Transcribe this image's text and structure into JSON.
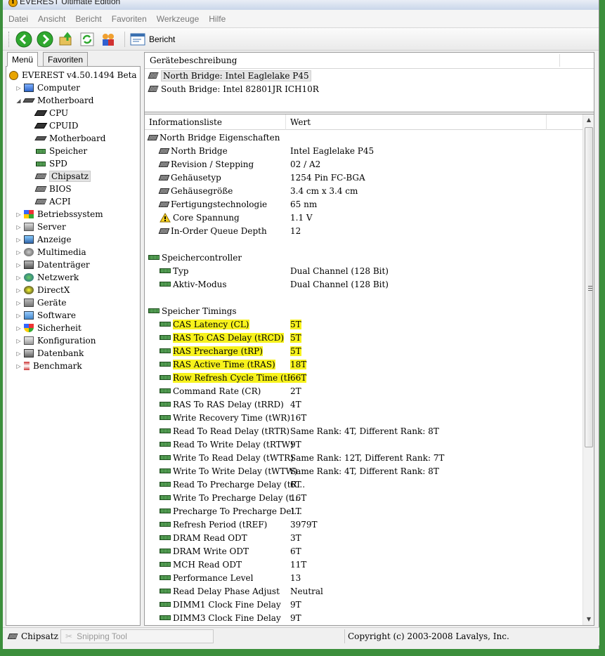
{
  "window": {
    "title": "EVEREST Ultimate Edition"
  },
  "menu": [
    "Datei",
    "Ansicht",
    "Bericht",
    "Favoriten",
    "Werkzeuge",
    "Hilfe"
  ],
  "toolbar": {
    "report_label": "Bericht"
  },
  "left_tabs": {
    "menu": "Menü",
    "favorites": "Favoriten"
  },
  "tree": [
    {
      "label": "EVEREST v4.50.1494 Beta",
      "icon": "info-icon",
      "level": 0,
      "exp": ""
    },
    {
      "label": "Computer",
      "icon": "computer-icon",
      "level": 1,
      "exp": "▷"
    },
    {
      "label": "Motherboard",
      "icon": "motherboard-icon",
      "level": 1,
      "exp": "◢"
    },
    {
      "label": "CPU",
      "icon": "cpu-icon",
      "level": 2,
      "exp": ""
    },
    {
      "label": "CPUID",
      "icon": "cpu-icon",
      "level": 2,
      "exp": ""
    },
    {
      "label": "Motherboard",
      "icon": "motherboard-icon",
      "level": 2,
      "exp": ""
    },
    {
      "label": "Speicher",
      "icon": "memory-icon",
      "level": 2,
      "exp": ""
    },
    {
      "label": "SPD",
      "icon": "memory-icon",
      "level": 2,
      "exp": ""
    },
    {
      "label": "Chipsatz",
      "icon": "chip-icon",
      "level": 2,
      "exp": "",
      "selected": true
    },
    {
      "label": "BIOS",
      "icon": "chip-icon",
      "level": 2,
      "exp": ""
    },
    {
      "label": "ACPI",
      "icon": "chip-icon",
      "level": 2,
      "exp": ""
    },
    {
      "label": "Betriebssystem",
      "icon": "windows-icon",
      "level": 1,
      "exp": "▷"
    },
    {
      "label": "Server",
      "icon": "server-icon",
      "level": 1,
      "exp": "▷"
    },
    {
      "label": "Anzeige",
      "icon": "monitor-icon",
      "level": 1,
      "exp": "▷"
    },
    {
      "label": "Multimedia",
      "icon": "speaker-icon",
      "level": 1,
      "exp": "▷"
    },
    {
      "label": "Datenträger",
      "icon": "drive-icon",
      "level": 1,
      "exp": "▷"
    },
    {
      "label": "Netzwerk",
      "icon": "network-icon",
      "level": 1,
      "exp": "▷"
    },
    {
      "label": "DirectX",
      "icon": "directx-icon",
      "level": 1,
      "exp": "▷"
    },
    {
      "label": "Geräte",
      "icon": "devices-icon",
      "level": 1,
      "exp": "▷"
    },
    {
      "label": "Software",
      "icon": "software-icon",
      "level": 1,
      "exp": "▷"
    },
    {
      "label": "Sicherheit",
      "icon": "shield-icon",
      "level": 1,
      "exp": "▷"
    },
    {
      "label": "Konfiguration",
      "icon": "config-icon",
      "level": 1,
      "exp": "▷"
    },
    {
      "label": "Datenbank",
      "icon": "database-icon",
      "level": 1,
      "exp": "▷"
    },
    {
      "label": "Benchmark",
      "icon": "hourglass-icon",
      "level": 1,
      "exp": "▷"
    }
  ],
  "device_panel": {
    "header": "Gerätebeschreibung",
    "items": [
      {
        "label": "North Bridge: Intel Eaglelake P45",
        "selected": true
      },
      {
        "label": "South Bridge: Intel 82801JR ICH10R",
        "selected": false
      }
    ]
  },
  "info_list": {
    "col_name": "Informationsliste",
    "col_value": "Wert",
    "rows": [
      {
        "name": "North Bridge Eigenschaften",
        "value": "",
        "icon": "chip",
        "indent": 0
      },
      {
        "name": "North Bridge",
        "value": "Intel Eaglelake P45",
        "icon": "chip",
        "indent": 1
      },
      {
        "name": "Revision / Stepping",
        "value": "02 / A2",
        "icon": "chip",
        "indent": 1
      },
      {
        "name": "Gehäusetyp",
        "value": "1254 Pin FC-BGA",
        "icon": "chip",
        "indent": 1
      },
      {
        "name": "Gehäusegröße",
        "value": "3.4 cm x 3.4 cm",
        "icon": "chip",
        "indent": 1
      },
      {
        "name": "Fertigungstechnologie",
        "value": "65 nm",
        "icon": "chip",
        "indent": 1
      },
      {
        "name": "Core Spannung",
        "value": "1.1 V",
        "icon": "warn",
        "indent": 1
      },
      {
        "name": "In-Order Queue Depth",
        "value": "12",
        "icon": "chip",
        "indent": 1
      },
      {
        "name": "",
        "value": "",
        "icon": "",
        "indent": 0
      },
      {
        "name": "Speichercontroller",
        "value": "",
        "icon": "ram",
        "indent": 0
      },
      {
        "name": "Typ",
        "value": "Dual Channel  (128 Bit)",
        "icon": "ram",
        "indent": 1
      },
      {
        "name": "Aktiv-Modus",
        "value": "Dual Channel  (128 Bit)",
        "icon": "ram",
        "indent": 1
      },
      {
        "name": "",
        "value": "",
        "icon": "",
        "indent": 0
      },
      {
        "name": "Speicher Timings",
        "value": "",
        "icon": "ram",
        "indent": 0
      },
      {
        "name": "CAS Latency (CL)",
        "value": "5T",
        "icon": "ram",
        "indent": 1,
        "hl": true
      },
      {
        "name": "RAS To CAS Delay (tRCD)",
        "value": "5T",
        "icon": "ram",
        "indent": 1,
        "hl": true
      },
      {
        "name": "RAS Precharge (tRP)",
        "value": "5T",
        "icon": "ram",
        "indent": 1,
        "hl": true
      },
      {
        "name": "RAS Active Time (tRAS)",
        "value": "18T",
        "icon": "ram",
        "indent": 1,
        "hl": true
      },
      {
        "name": "Row Refresh Cycle Time (tRF...",
        "value": "66T",
        "icon": "ram",
        "indent": 1,
        "hl": true
      },
      {
        "name": "Command Rate (CR)",
        "value": "2T",
        "icon": "ram",
        "indent": 1
      },
      {
        "name": "RAS To RAS Delay (tRRD)",
        "value": "4T",
        "icon": "ram",
        "indent": 1
      },
      {
        "name": "Write Recovery Time (tWR)",
        "value": "16T",
        "icon": "ram",
        "indent": 1
      },
      {
        "name": "Read To Read Delay (tRTR)",
        "value": "Same Rank: 4T, Different Rank: 8T",
        "icon": "ram",
        "indent": 1
      },
      {
        "name": "Read To Write Delay (tRTW)",
        "value": "9T",
        "icon": "ram",
        "indent": 1
      },
      {
        "name": "Write To Read Delay (tWTR)",
        "value": "Same Rank: 12T, Different Rank: 7T",
        "icon": "ram",
        "indent": 1
      },
      {
        "name": "Write To Write Delay (tWTW)",
        "value": "Same Rank: 4T, Different Rank: 8T",
        "icon": "ram",
        "indent": 1
      },
      {
        "name": "Read To Precharge Delay (tR...",
        "value": "6T",
        "icon": "ram",
        "indent": 1
      },
      {
        "name": "Write To Precharge Delay (t...",
        "value": "16T",
        "icon": "ram",
        "indent": 1
      },
      {
        "name": "Precharge To Precharge Del...",
        "value": "1T",
        "icon": "ram",
        "indent": 1
      },
      {
        "name": "Refresh Period (tREF)",
        "value": "3979T",
        "icon": "ram",
        "indent": 1
      },
      {
        "name": "DRAM Read ODT",
        "value": "3T",
        "icon": "ram",
        "indent": 1
      },
      {
        "name": "DRAM Write ODT",
        "value": "6T",
        "icon": "ram",
        "indent": 1
      },
      {
        "name": "MCH Read ODT",
        "value": "11T",
        "icon": "ram",
        "indent": 1
      },
      {
        "name": "Performance Level",
        "value": "13",
        "icon": "ram",
        "indent": 1
      },
      {
        "name": "Read Delay Phase Adjust",
        "value": "Neutral",
        "icon": "ram",
        "indent": 1
      },
      {
        "name": "DIMM1 Clock Fine Delay",
        "value": "9T",
        "icon": "ram",
        "indent": 1
      },
      {
        "name": "DIMM3 Clock Fine Delay",
        "value": "9T",
        "icon": "ram",
        "indent": 1
      }
    ]
  },
  "statusbar": {
    "current": "Chipsatz",
    "snipping": "Snipping Tool",
    "copyright": "Copyright (c) 2003-2008 Lavalys, Inc."
  }
}
